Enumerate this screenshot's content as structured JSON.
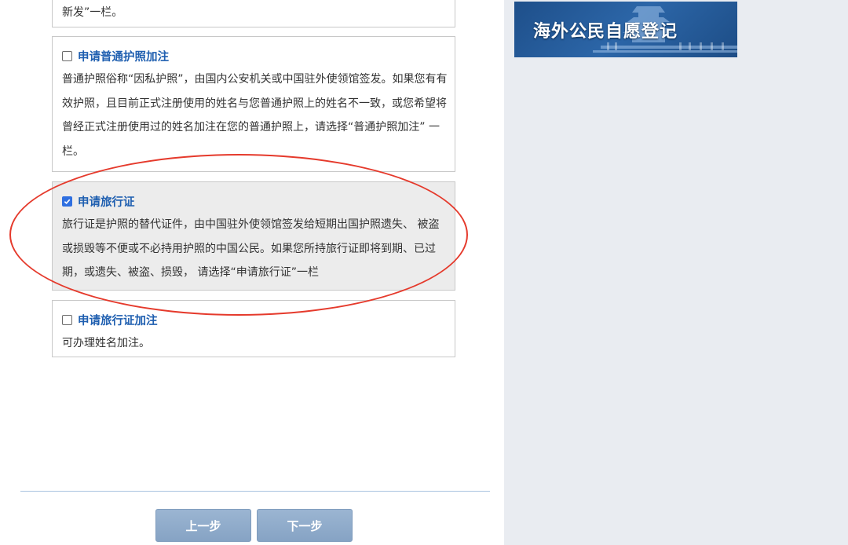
{
  "top_fragment_text": "新发”一栏。",
  "options": [
    {
      "title": "申请普通护照加注",
      "checked": false,
      "description": "普通护照俗称“因私护照”，由国内公安机关或中国驻外使领馆签发。如果您有有效护照，且目前正式注册使用的姓名与您普通护照上的姓名不一致，或您希望将曾经正式注册使用过的姓名加注在您的普通护照上，请选择“普通护照加注” 一栏。"
    },
    {
      "title": "申请旅行证",
      "checked": true,
      "description": "旅行证是护照的替代证件，由中国驻外使领馆签发给短期出国护照遗失、 被盗或损毁等不便或不必持用护照的中国公民。如果您所持旅行证即将到期、已过期，或遗失、被盗、损毁， 请选择“申请旅行证”一栏"
    },
    {
      "title": "申请旅行证加注",
      "checked": false,
      "description": "可办理姓名加注。"
    }
  ],
  "buttons": {
    "prev": "上一步",
    "next": "下一步"
  },
  "banner": {
    "text": "海外公民自愿登记"
  },
  "colors": {
    "option_title": "#1f5fb0",
    "annotation": "#e53a2c",
    "button_bg": "#8fabcb",
    "sidebar_bg": "#e9ecf1"
  }
}
